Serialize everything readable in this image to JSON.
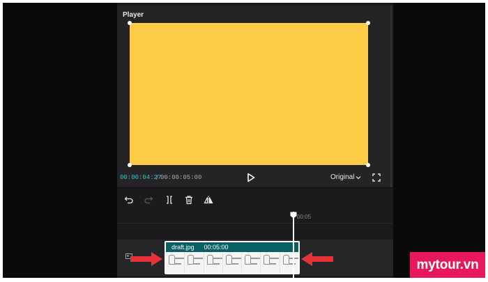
{
  "player": {
    "title": "Player",
    "current_time": "00:00:04:27",
    "separator": "/",
    "total_time": "00:00:05:00",
    "ratio": "Original",
    "frame_color": "#fecb47"
  },
  "timeline": {
    "ruler_label": "00:05",
    "clip": {
      "name": "draft.jpg",
      "duration": "00:05:00"
    }
  },
  "icons": {
    "undo": "undo-icon",
    "redo": "redo-icon",
    "split": "split-icon",
    "delete": "trash-icon",
    "mirror": "mirror-icon",
    "play": "play-icon",
    "fullscreen": "fullscreen-icon"
  },
  "colors": {
    "accent": "#2ec5cf",
    "clip": "#0b6466",
    "arrow": "#e8323a",
    "brand": "#e8185c"
  },
  "watermark": {
    "text": "mytour.vn"
  }
}
